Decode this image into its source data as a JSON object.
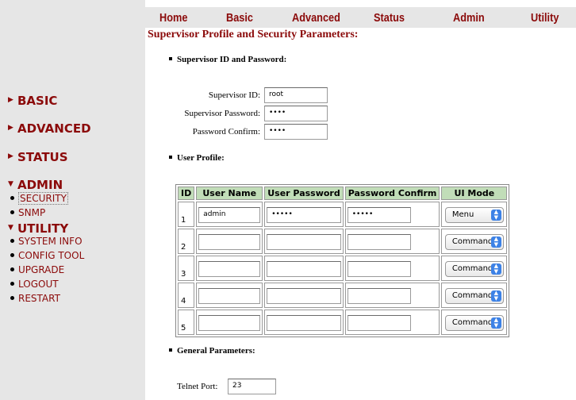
{
  "topnav": [
    "Home",
    "Basic",
    "Advanced",
    "Status",
    "Admin",
    "Utility"
  ],
  "page_title": "Supervisor Profile and Security Parameters:",
  "supervisor": {
    "heading": "Supervisor ID and Password:",
    "id_label": "Supervisor ID:",
    "id_value": "root",
    "password_label": "Supervisor Password:",
    "password_value": "••••",
    "confirm_label": "Password Confirm:",
    "confirm_value": "••••"
  },
  "user_profile": {
    "heading": "User Profile:",
    "columns": [
      "ID",
      "User Name",
      "User Password",
      "Password Confirm",
      "UI Mode"
    ],
    "rows": [
      {
        "id": "1",
        "name": "admin",
        "password": "•••••",
        "confirm": "•••••",
        "mode": "Menu"
      },
      {
        "id": "2",
        "name": "",
        "password": "",
        "confirm": "",
        "mode": "Command"
      },
      {
        "id": "3",
        "name": "",
        "password": "",
        "confirm": "",
        "mode": "Command"
      },
      {
        "id": "4",
        "name": "",
        "password": "",
        "confirm": "",
        "mode": "Command"
      },
      {
        "id": "5",
        "name": "",
        "password": "",
        "confirm": "",
        "mode": "Command"
      }
    ]
  },
  "general": {
    "heading": "General Parameters:",
    "telnet_label": "Telnet Port:",
    "telnet_value": "23"
  },
  "sidebar": {
    "basic": "BASIC",
    "advanced": "ADVANCED",
    "status": "STATUS",
    "admin": "ADMIN",
    "admin_items": [
      "SECURITY",
      "SNMP"
    ],
    "utility": "UTILITY",
    "utility_items": [
      "SYSTEM INFO",
      "CONFIG TOOL",
      "UPGRADE",
      "LOGOUT",
      "RESTART"
    ]
  },
  "colors": {
    "brand": "#8b0a0a",
    "table_header": "#c1ddb8",
    "sidebar_bg": "#e6e6e6",
    "select_knob": "#3d82e6"
  }
}
